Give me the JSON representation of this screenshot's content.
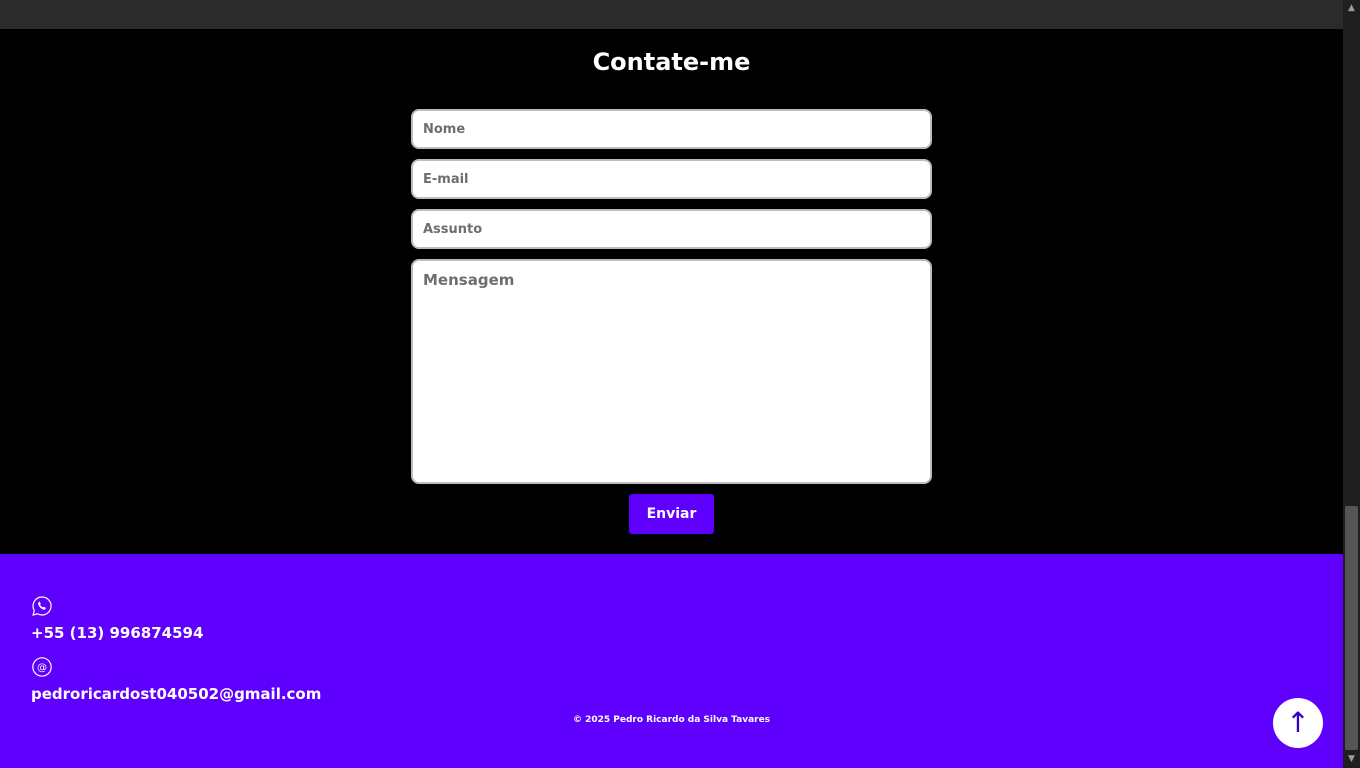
{
  "contact": {
    "title": "Contate-me",
    "name_placeholder": "Nome",
    "email_placeholder": "E-mail",
    "subject_placeholder": "Assunto",
    "message_placeholder": "Mensagem",
    "send_label": "Enviar"
  },
  "footer": {
    "phone_icon": "whatsapp-icon",
    "phone": "+55 (13) 996874594",
    "email_icon": "at-icon",
    "email": "pedroricardost040502@gmail.com",
    "copyright": "© 2025 Pedro Ricardo da Silva Tavares",
    "to_top_label": "↑"
  },
  "colors": {
    "accent": "#5f00ff",
    "background": "#000000",
    "topbar": "#2b2b2b"
  }
}
